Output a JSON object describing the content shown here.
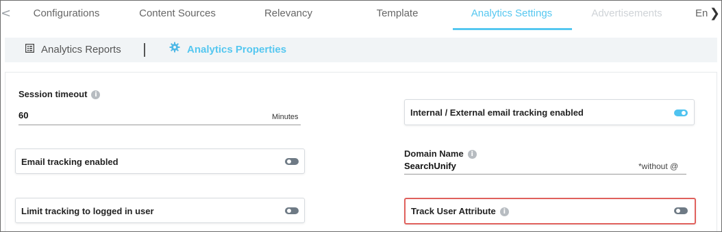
{
  "tabs": [
    {
      "label": "Configurations",
      "state": "normal"
    },
    {
      "label": "Content Sources",
      "state": "normal"
    },
    {
      "label": "Relevancy",
      "state": "normal"
    },
    {
      "label": "Template",
      "state": "normal"
    },
    {
      "label": "Analytics Settings",
      "state": "active"
    },
    {
      "label": "Advertisements",
      "state": "disabled"
    },
    {
      "label": "En",
      "state": "normal"
    }
  ],
  "nav": {
    "left_arrow": "<",
    "right_arrow": "❯"
  },
  "subtabs": [
    {
      "label": "Analytics Reports",
      "icon": "report-icon",
      "active": false
    },
    {
      "label": "Analytics Properties",
      "icon": "gear-icon",
      "active": true
    }
  ],
  "session_timeout": {
    "label": "Session timeout",
    "value": "60",
    "suffix": "Minutes"
  },
  "email_tracking": {
    "label": "Email tracking enabled",
    "enabled": false
  },
  "limit_tracking": {
    "label": "Limit tracking to logged in user",
    "enabled": false
  },
  "internal_external": {
    "label": "Internal / External email tracking enabled",
    "enabled": true
  },
  "domain_name": {
    "label": "Domain Name",
    "value": "SearchUnify",
    "suffix": "*without @"
  },
  "track_user_attribute": {
    "label": "Track User Attribute",
    "enabled": false
  },
  "colors": {
    "accent": "#55c7f0",
    "highlight_border": "#e0605c",
    "toggle_off": "#6e7a85",
    "toggle_on": "#4fc3f0"
  }
}
